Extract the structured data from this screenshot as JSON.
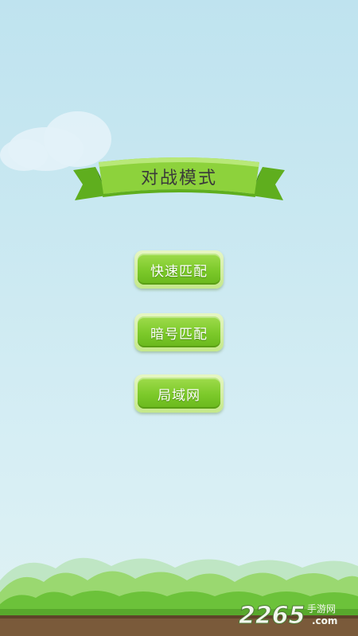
{
  "screen": {
    "title": "对战模式"
  },
  "menu": {
    "items": [
      {
        "id": "quick-match",
        "label": "快速匹配"
      },
      {
        "id": "code-match",
        "label": "暗号匹配"
      },
      {
        "id": "lan",
        "label": "局域网"
      }
    ]
  },
  "watermark": {
    "number": "2265",
    "text": "手游网",
    "domain": ".com"
  },
  "colors": {
    "sky_top": "#bfe3ef",
    "sky_bottom": "#dff2f3",
    "ribbon_green": "#7cc92a",
    "button_green": "#7cc92a",
    "button_text": "#ffffff",
    "title_text": "#3a3a3a",
    "grass": "#6cc23a",
    "soil": "#7a5a3a"
  }
}
